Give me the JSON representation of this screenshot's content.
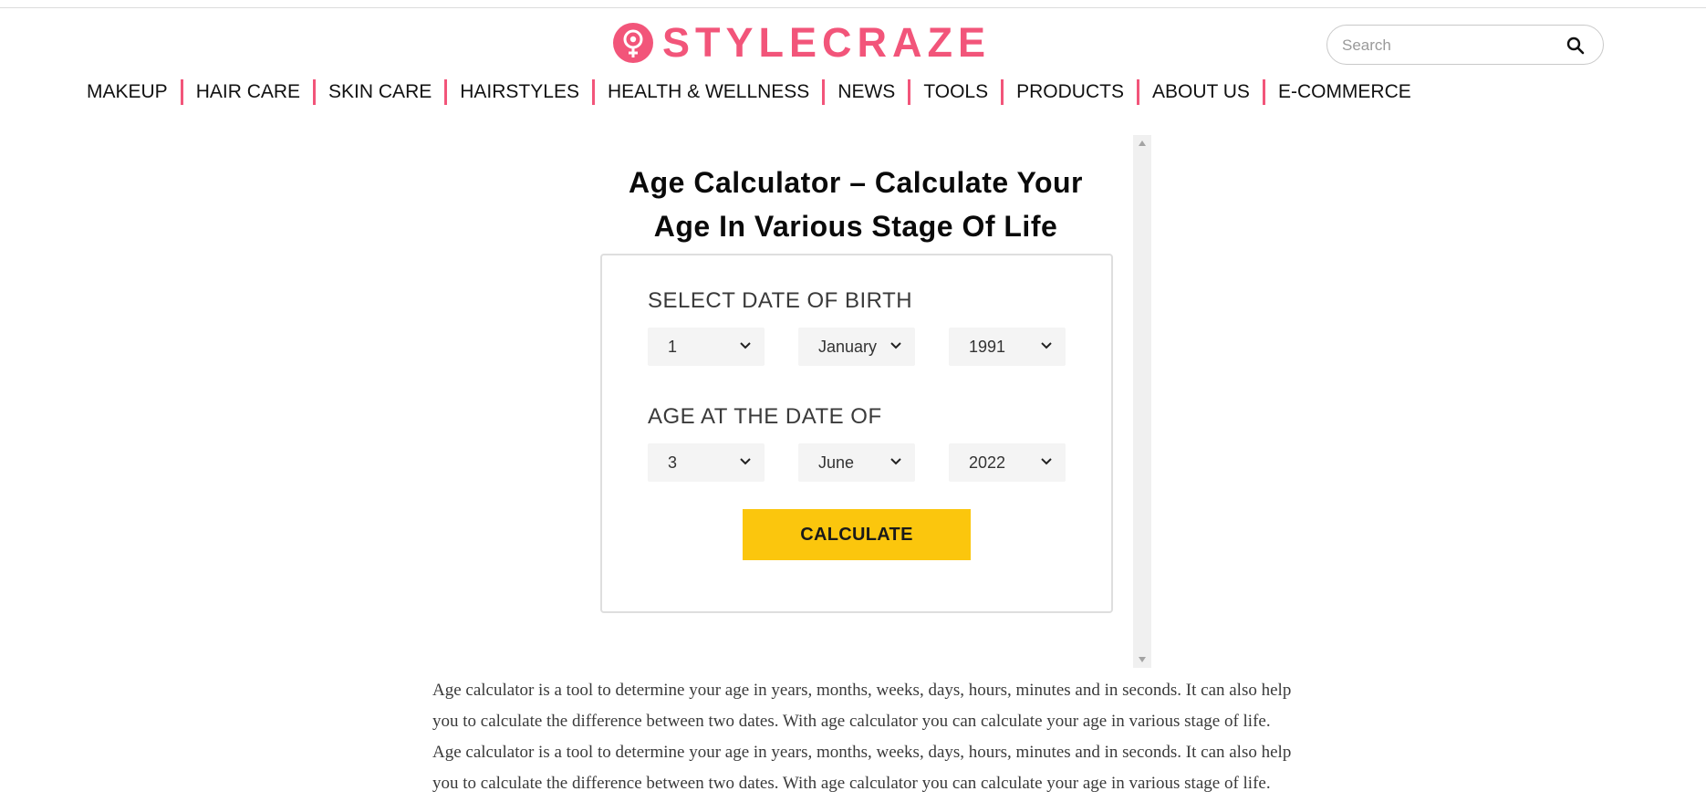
{
  "brand": {
    "name": "STYLECRAZE",
    "color": "#f2557a"
  },
  "search": {
    "placeholder": "Search",
    "icon": "search-icon"
  },
  "nav": {
    "items": [
      {
        "label": "MAKEUP"
      },
      {
        "label": "HAIR CARE"
      },
      {
        "label": "SKIN CARE"
      },
      {
        "label": "HAIRSTYLES"
      },
      {
        "label": "HEALTH & WELLNESS"
      },
      {
        "label": "NEWS"
      },
      {
        "label": "TOOLS"
      },
      {
        "label": "PRODUCTS"
      },
      {
        "label": "ABOUT US"
      },
      {
        "label": "E-COMMERCE"
      }
    ]
  },
  "calculator": {
    "title_line1": "Age Calculator – Calculate Your",
    "title_line2": "Age In Various Stage Of Life",
    "dob_label": "SELECT DATE OF BIRTH",
    "dob": {
      "day": "1",
      "month": "January",
      "year": "1991"
    },
    "at_label": "AGE AT THE DATE OF",
    "at": {
      "day": "3",
      "month": "June",
      "year": "2022"
    },
    "button_label": "CALCULATE",
    "button_color": "#fbc60d"
  },
  "article": {
    "paragraphs": [
      "Age calculator is a tool to determine your age in years, months, weeks, days, hours, minutes and in seconds. It can also help you to calculate the difference between two dates. With age calculator you can calculate your age in various stage of life.",
      "Age calculator is a tool to determine your age in years, months, weeks, days, hours, minutes and in seconds. It can also help you to calculate the difference between two dates. With age calculator you can calculate your age in various stage of life."
    ]
  }
}
